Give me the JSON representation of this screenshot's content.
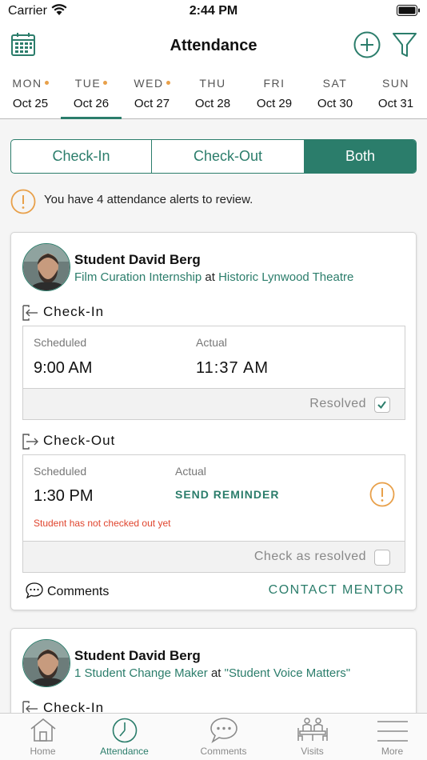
{
  "status_bar": {
    "carrier": "Carrier",
    "time": "2:44 PM"
  },
  "header": {
    "title": "Attendance"
  },
  "days": [
    {
      "name": "MON",
      "date": "Oct 25",
      "dot": true
    },
    {
      "name": "TUE",
      "date": "Oct 26",
      "dot": true,
      "selected": true
    },
    {
      "name": "WED",
      "date": "Oct 27",
      "dot": true
    },
    {
      "name": "THU",
      "date": "Oct 28",
      "dot": false
    },
    {
      "name": "FRI",
      "date": "Oct 29",
      "dot": false
    },
    {
      "name": "SAT",
      "date": "Oct 30",
      "dot": false
    },
    {
      "name": "SUN",
      "date": "Oct 31",
      "dot": false
    }
  ],
  "segments": {
    "checkin": "Check-In",
    "checkout": "Check-Out",
    "both": "Both",
    "active": "both"
  },
  "alert": {
    "text": "You have 4 attendance alerts to review."
  },
  "cards": [
    {
      "student": "Student David Berg",
      "program": "Film Curation Internship",
      "at": "at",
      "site": "Historic Lynwood Theatre",
      "checkin": {
        "label": "Check-In",
        "scheduled_label": "Scheduled",
        "scheduled": "9:00 AM",
        "actual_label": "Actual",
        "actual": "11:37 AM",
        "resolved_label": "Resolved",
        "resolved": true
      },
      "checkout": {
        "label": "Check-Out",
        "scheduled_label": "Scheduled",
        "scheduled": "1:30 PM",
        "actual_label": "Actual",
        "send_reminder": "SEND REMINDER",
        "warning": "Student has not checked out yet",
        "resolve_label": "Check as resolved",
        "resolved": false
      },
      "comments_label": "Comments",
      "contact_label": "CONTACT MENTOR"
    },
    {
      "student": "Student David Berg",
      "program": "1 Student Change Maker",
      "at": "at",
      "site": "\"Student Voice Matters\"",
      "checkin": {
        "label": "Check-In"
      }
    }
  ],
  "tabbar": [
    {
      "label": "Home",
      "icon": "home-icon"
    },
    {
      "label": "Attendance",
      "icon": "clock-icon",
      "active": true
    },
    {
      "label": "Comments",
      "icon": "chat-bubble-icon"
    },
    {
      "label": "Visits",
      "icon": "visits-icon"
    },
    {
      "label": "More",
      "icon": "menu-icon"
    }
  ],
  "colors": {
    "accent": "#2b7d6b",
    "warning": "#e8a04a",
    "error": "#e0452e"
  }
}
